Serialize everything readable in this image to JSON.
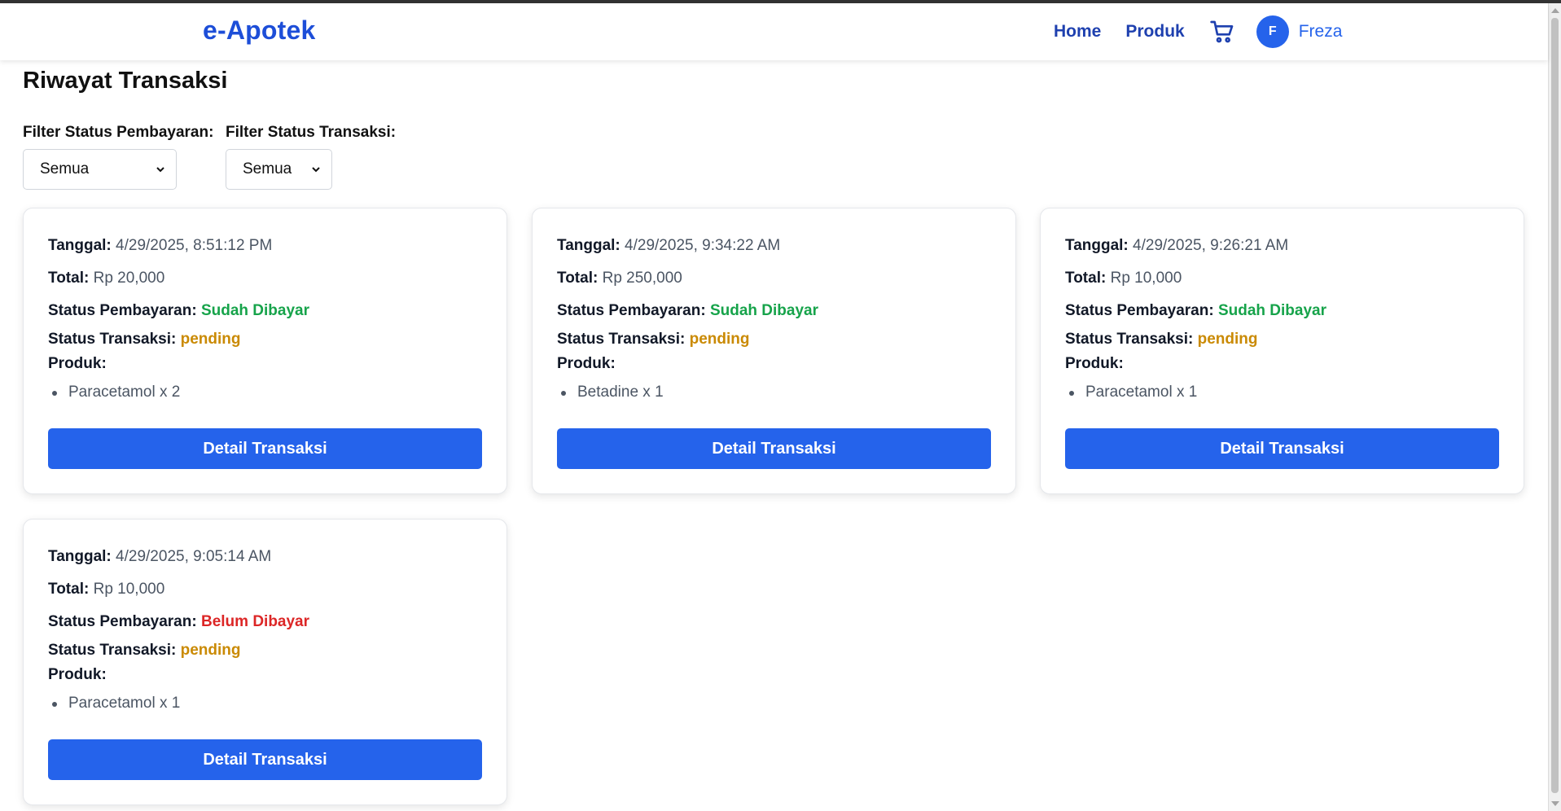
{
  "brand": "e-Apotek",
  "nav": {
    "home": "Home",
    "produk": "Produk",
    "cart_icon": "shopping-cart-icon",
    "avatar_initial": "F",
    "username": "Freza"
  },
  "page": {
    "title": "Riwayat Transaksi"
  },
  "filters": {
    "payment_label": "Filter Status Pembayaran:",
    "payment_value": "Semua",
    "transaction_label": "Filter Status Transaksi:",
    "transaction_value": "Semua"
  },
  "labels": {
    "tanggal": "Tanggal:",
    "total": "Total:",
    "status_pembayaran": "Status Pembayaran:",
    "status_transaksi": "Status Transaksi:",
    "produk": "Produk:",
    "detail_button": "Detail Transaksi"
  },
  "colors": {
    "primary": "#2563eb",
    "paid": "#16a34a",
    "unpaid": "#dc2626",
    "pending": "#ca8a04"
  },
  "transactions": [
    {
      "tanggal": "4/29/2025, 8:51:12 PM",
      "total": "Rp 20,000",
      "status_pembayaran": "Sudah Dibayar",
      "status_transaksi": "pending",
      "produk": [
        "Paracetamol x 2"
      ]
    },
    {
      "tanggal": "4/29/2025, 9:34:22 AM",
      "total": "Rp 250,000",
      "status_pembayaran": "Sudah Dibayar",
      "status_transaksi": "pending",
      "produk": [
        "Betadine x 1"
      ]
    },
    {
      "tanggal": "4/29/2025, 9:26:21 AM",
      "total": "Rp 10,000",
      "status_pembayaran": "Sudah Dibayar",
      "status_transaksi": "pending",
      "produk": [
        "Paracetamol x 1"
      ]
    },
    {
      "tanggal": "4/29/2025, 9:05:14 AM",
      "total": "Rp 10,000",
      "status_pembayaran": "Belum Dibayar",
      "status_transaksi": "pending",
      "produk": [
        "Paracetamol x 1"
      ]
    }
  ]
}
